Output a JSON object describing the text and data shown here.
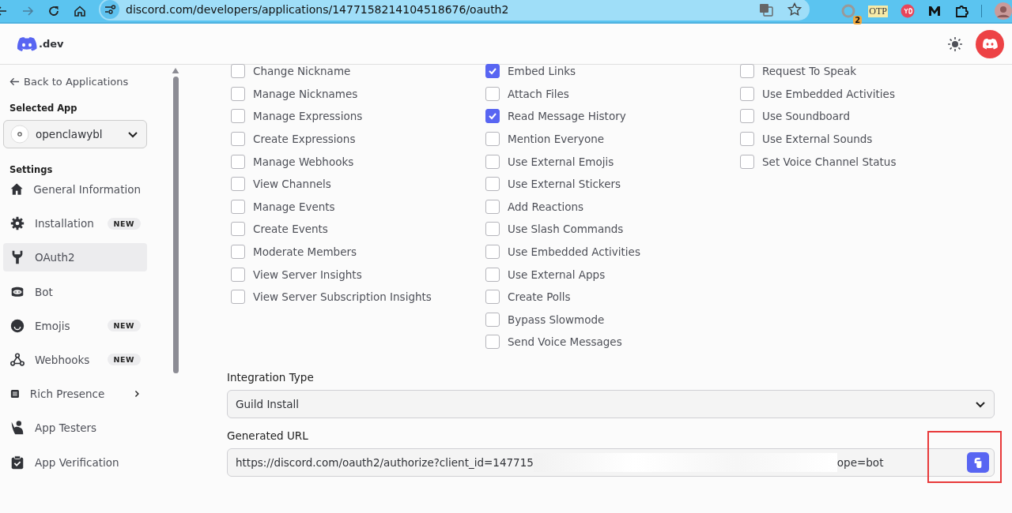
{
  "browser": {
    "url": "discord.com/developers/applications/1477158214104518676/oauth2",
    "extension_badge": "2",
    "otp_label": "OTP"
  },
  "header": {
    "logo_text": ".dev"
  },
  "sidebar": {
    "back_link": "Back to Applications",
    "selected_app_label": "Selected App",
    "app_name": "openclawybl",
    "settings_label": "Settings",
    "items": [
      {
        "label": "General Information",
        "selected": false,
        "submenu": false
      },
      {
        "label": "Installation",
        "badge": "NEW",
        "selected": false,
        "submenu": false
      },
      {
        "label": "OAuth2",
        "selected": true,
        "submenu": false
      },
      {
        "label": "Bot",
        "selected": false,
        "submenu": false
      },
      {
        "label": "Emojis",
        "badge": "NEW",
        "selected": false,
        "submenu": false
      },
      {
        "label": "Webhooks",
        "badge": "NEW",
        "selected": false,
        "submenu": false
      },
      {
        "label": "Rich Presence",
        "selected": false,
        "submenu": true
      },
      {
        "label": "App Testers",
        "selected": false,
        "submenu": false
      },
      {
        "label": "App Verification",
        "selected": false,
        "submenu": false
      }
    ]
  },
  "permissions": [
    [
      {
        "label": "Change Nickname",
        "checked": false
      },
      {
        "label": "Manage Nicknames",
        "checked": false
      },
      {
        "label": "Manage Expressions",
        "checked": false
      },
      {
        "label": "Create Expressions",
        "checked": false
      },
      {
        "label": "Manage Webhooks",
        "checked": false
      },
      {
        "label": "View Channels",
        "checked": false
      },
      {
        "label": "Manage Events",
        "checked": false
      },
      {
        "label": "Create Events",
        "checked": false
      },
      {
        "label": "Moderate Members",
        "checked": false
      },
      {
        "label": "View Server Insights",
        "checked": false
      },
      {
        "label": "View Server Subscription Insights",
        "checked": false
      }
    ],
    [
      {
        "label": "Embed Links",
        "checked": true
      },
      {
        "label": "Attach Files",
        "checked": false
      },
      {
        "label": "Read Message History",
        "checked": true
      },
      {
        "label": "Mention Everyone",
        "checked": false
      },
      {
        "label": "Use External Emojis",
        "checked": false
      },
      {
        "label": "Use External Stickers",
        "checked": false
      },
      {
        "label": "Add Reactions",
        "checked": false
      },
      {
        "label": "Use Slash Commands",
        "checked": false
      },
      {
        "label": "Use Embedded Activities",
        "checked": false
      },
      {
        "label": "Use External Apps",
        "checked": false
      },
      {
        "label": "Create Polls",
        "checked": false
      },
      {
        "label": "Bypass Slowmode",
        "checked": false
      },
      {
        "label": "Send Voice Messages",
        "checked": false
      }
    ],
    [
      {
        "label": "Request To Speak",
        "checked": false
      },
      {
        "label": "Use Embedded Activities",
        "checked": false
      },
      {
        "label": "Use Soundboard",
        "checked": false
      },
      {
        "label": "Use External Sounds",
        "checked": false
      },
      {
        "label": "Set Voice Channel Status",
        "checked": false
      }
    ]
  ],
  "integration_type": {
    "label": "Integration Type",
    "value": "Guild Install"
  },
  "generated_url": {
    "label": "Generated URL",
    "value_start": "https://discord.com/oauth2/authorize?client_id=147715",
    "value_end": "ope=bot",
    "redacted": true,
    "copy_highlighted": true
  }
}
